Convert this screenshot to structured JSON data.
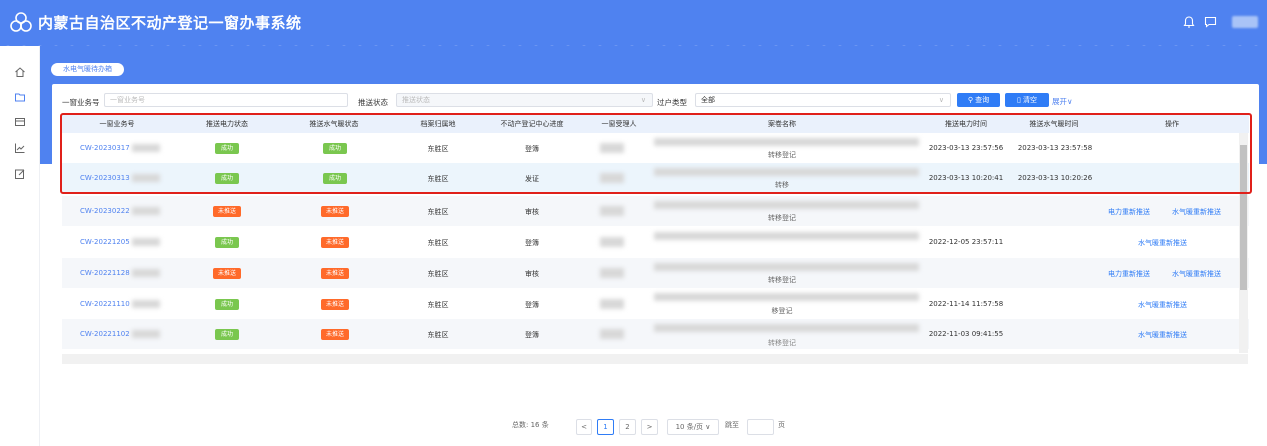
{
  "header": {
    "title": "内蒙古自治区不动产登记一窗办事系统"
  },
  "icons": {
    "logo": "logo-icon",
    "bell": "bell-icon",
    "message": "message-icon",
    "sidebar": [
      "home-icon",
      "folder-icon",
      "card-icon",
      "chart-icon",
      "edit-icon"
    ]
  },
  "tab": {
    "label": "水电气暖待办箱"
  },
  "filters": {
    "business_no_label": "一窗业务号",
    "business_no_placeholder": "一窗业务号",
    "push_status_label": "推送状态",
    "push_status_placeholder": "推送状态",
    "transfer_type_label": "过户类型",
    "transfer_type_value": "全部",
    "search_button": "查询",
    "clear_button": "清空",
    "expand_link": "展开∨"
  },
  "table": {
    "columns": [
      "一窗业务号",
      "推送电力状态",
      "推送水气暖状态",
      "档案归属地",
      "不动产登记中心进度",
      "一窗受理人",
      "案卷名称",
      "推送电力时间",
      "推送水气暖时间",
      "操作"
    ],
    "rows": [
      {
        "code": "CW-20230317",
        "power_status": "成功",
        "water_status": "成功",
        "archive": "东胜区",
        "progress": "登簿",
        "case_suffix": "转移登记",
        "power_time": "2023-03-13 23:57:56",
        "water_time": "2023-03-13 23:57:58",
        "action1": "",
        "action2": ""
      },
      {
        "code": "CW-20230313",
        "power_status": "成功",
        "water_status": "成功",
        "archive": "东胜区",
        "progress": "发证",
        "case_suffix": "转移",
        "power_time": "2023-03-13 10:20:41",
        "water_time": "2023-03-13 10:20:26",
        "action1": "",
        "action2": ""
      },
      {
        "code": "CW-20230222",
        "power_status": "未推送",
        "water_status": "未推送",
        "archive": "东胜区",
        "progress": "审核",
        "case_suffix": "转移登记",
        "power_time": "",
        "water_time": "",
        "action1": "电力重新推送",
        "action2": "水气暖重新推送"
      },
      {
        "code": "CW-20221205",
        "power_status": "成功",
        "water_status": "未推送",
        "archive": "东胜区",
        "progress": "登簿",
        "case_suffix": "",
        "power_time": "2022-12-05 23:57:11",
        "water_time": "",
        "action1": "",
        "action2": "水气暖重新推送"
      },
      {
        "code": "CW-20221128",
        "power_status": "未推送",
        "water_status": "未推送",
        "archive": "东胜区",
        "progress": "审核",
        "case_suffix": "转移登记",
        "power_time": "",
        "water_time": "",
        "action1": "电力重新推送",
        "action2": "水气暖重新推送"
      },
      {
        "code": "CW-20221110",
        "power_status": "成功",
        "water_status": "未推送",
        "archive": "东胜区",
        "progress": "登簿",
        "case_suffix": "移登记",
        "power_time": "2022-11-14 11:57:58",
        "water_time": "",
        "action1": "",
        "action2": "水气暖重新推送"
      },
      {
        "code": "CW-20221102",
        "power_status": "成功",
        "water_status": "未推送",
        "archive": "东胜区",
        "progress": "登簿",
        "case_suffix": "转移登记",
        "power_time": "2022-11-03 09:41:55",
        "water_time": "",
        "action1": "",
        "action2": "水气暖重新推送"
      }
    ]
  },
  "pagination": {
    "total_label": "总数:",
    "total": "16 条",
    "pages": [
      "1",
      "2"
    ],
    "current": "1",
    "page_size": "10 条/页",
    "goto_label": "跳至",
    "page_unit": "页",
    "prev": "<",
    "next": ">"
  },
  "colors": {
    "brand": "#4f82f0",
    "primary_button": "#2f7cf6",
    "success": "#7ac74f",
    "pending": "#ff6a2a",
    "highlight_border": "#e0201a"
  }
}
